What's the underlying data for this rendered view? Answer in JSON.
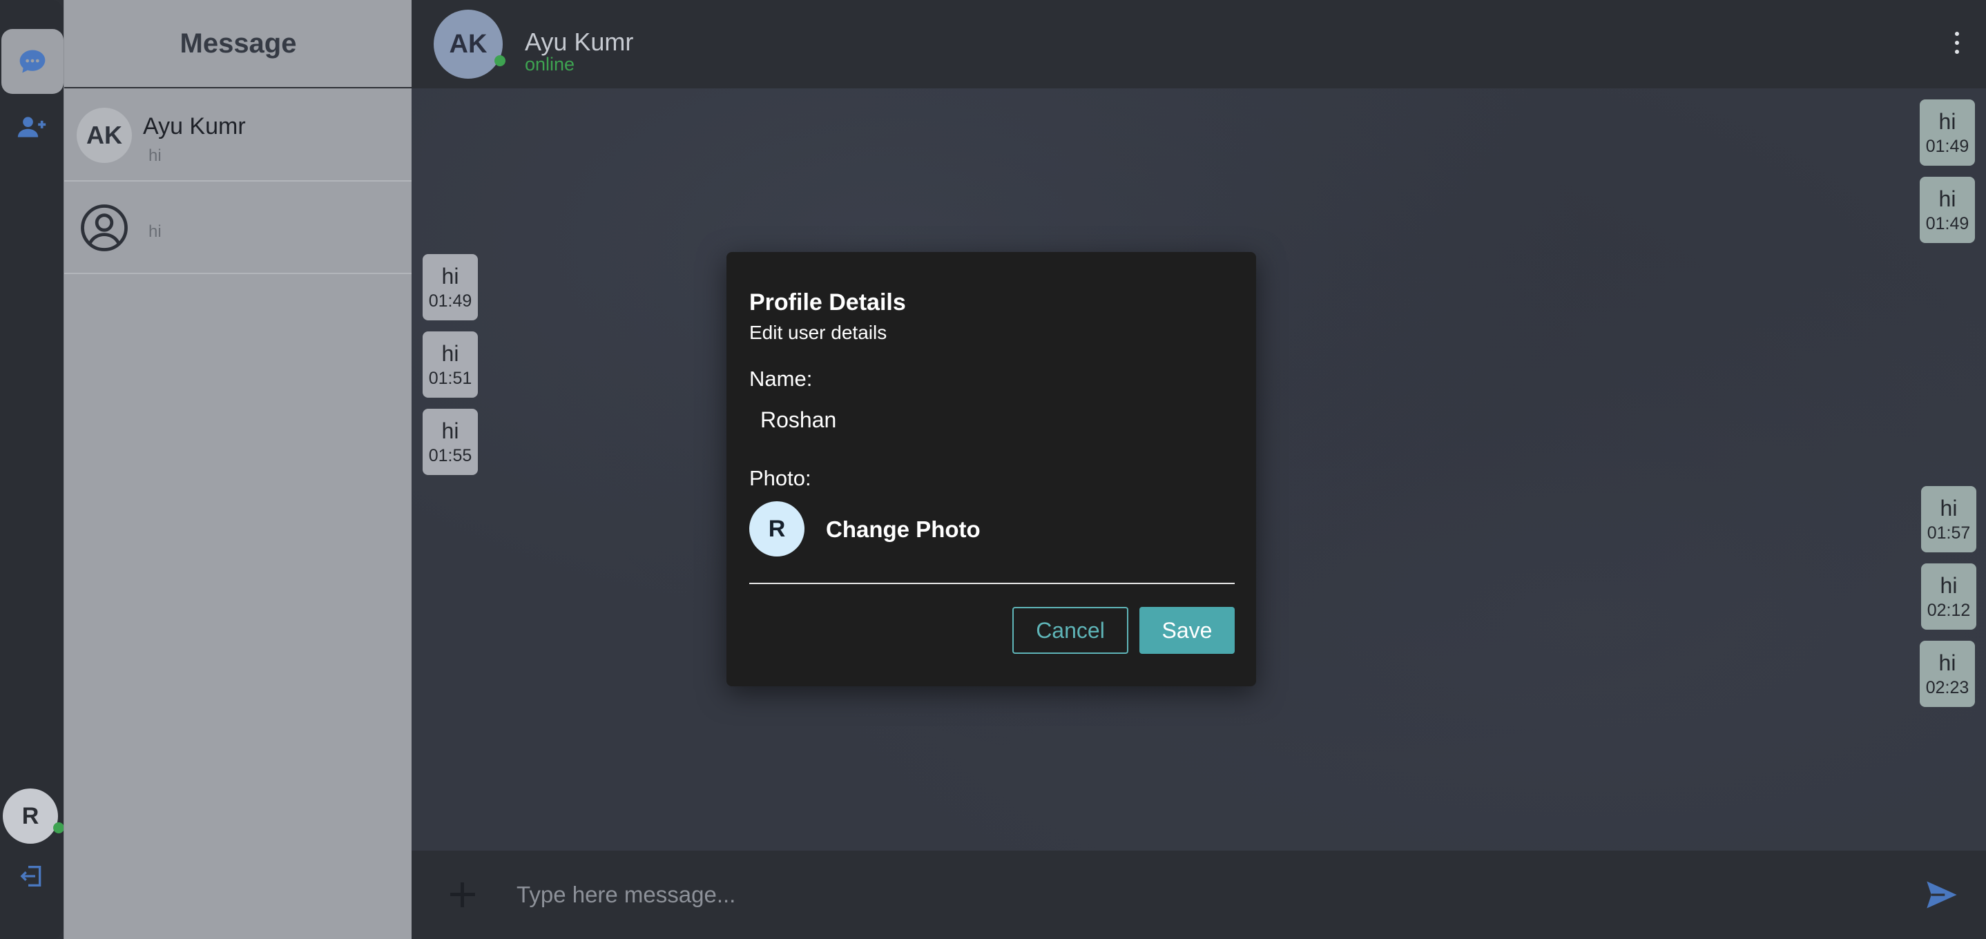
{
  "rail": {
    "chat_icon": "chat-bubble-icon",
    "add_user_icon": "add-user-icon",
    "user_avatar_initial": "R",
    "logout_icon": "logout-icon"
  },
  "sidebar": {
    "title": "Message",
    "conversations": [
      {
        "initials": "AK",
        "name": "Ayu Kumr",
        "preview": "hi"
      },
      {
        "initials": "",
        "name": "",
        "preview": "hi",
        "avatar_icon": "user-circle-icon"
      }
    ]
  },
  "chat": {
    "header": {
      "initials": "AK",
      "name": "Ayu Kumr",
      "status": "online",
      "menu_icon": "more-vertical-icon"
    },
    "messages": [
      {
        "side": "out",
        "text": "hi",
        "time": "01:49"
      },
      {
        "side": "out",
        "text": "hi",
        "time": "01:49"
      },
      {
        "side": "in",
        "text": "hi",
        "time": "01:49"
      },
      {
        "side": "in",
        "text": "hi",
        "time": "01:51"
      },
      {
        "side": "in",
        "text": "hi",
        "time": "01:55"
      },
      {
        "side": "out",
        "text": "hi",
        "time": "01:57"
      },
      {
        "side": "out",
        "text": "hi",
        "time": "02:12"
      },
      {
        "side": "out",
        "text": "hi",
        "time": "02:23"
      }
    ],
    "composer": {
      "placeholder": "Type here message...",
      "value": "",
      "attach_icon": "plus-icon",
      "send_icon": "send-icon"
    }
  },
  "modal": {
    "title": "Profile Details",
    "subtitle": "Edit user details",
    "name_label": "Name:",
    "name_value": "Roshan",
    "photo_label": "Photo:",
    "photo_initial": "R",
    "change_photo_label": "Change Photo",
    "cancel_label": "Cancel",
    "save_label": "Save"
  },
  "colors": {
    "accent": "#4ba8ad",
    "online": "#3ea351",
    "rail_icon": "#4a78c0"
  }
}
